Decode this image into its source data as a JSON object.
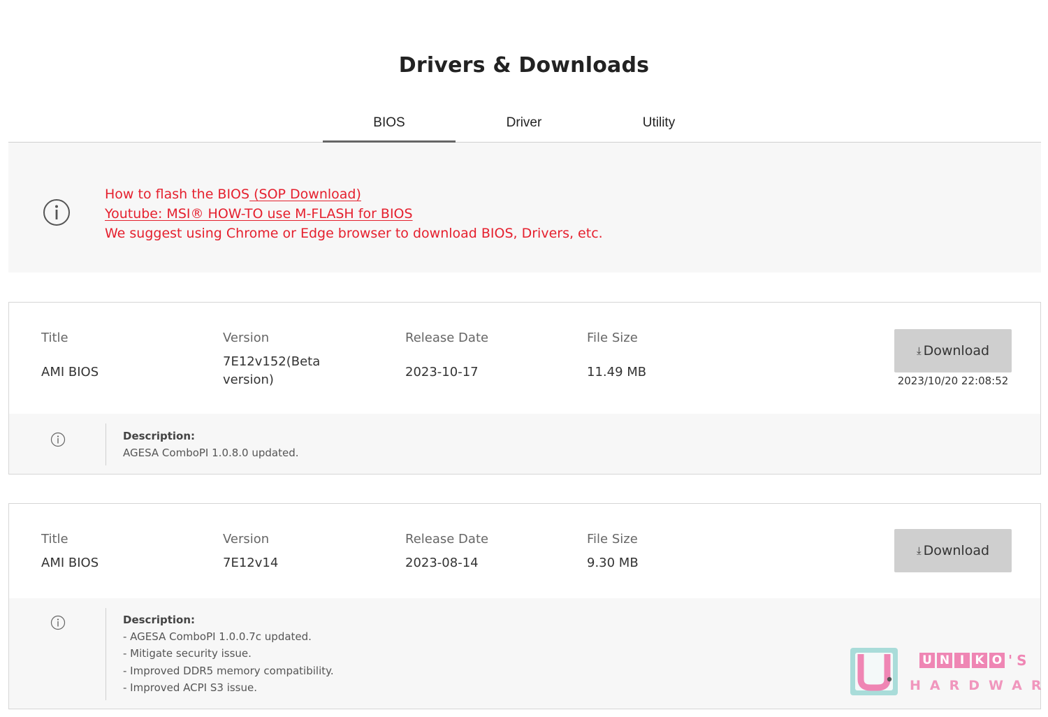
{
  "page": {
    "title": "Drivers & Downloads"
  },
  "tabs": [
    {
      "label": "BIOS",
      "active": true
    },
    {
      "label": "Driver",
      "active": false
    },
    {
      "label": "Utility",
      "active": false
    }
  ],
  "notice": {
    "line1_text": "How to flash the BIOS",
    "line1_link": " (SOP Download)",
    "line2_link": "Youtube: MSI® HOW-TO use M-FLASH for BIOS",
    "line3_text": "We suggest using Chrome or Edge browser to download BIOS, Drivers, etc.",
    "color": "#e5202e"
  },
  "columns": {
    "title": "Title",
    "version": "Version",
    "release_date": "Release Date",
    "file_size": "File Size"
  },
  "downloads": [
    {
      "title": "AMI BIOS",
      "version_line1": "7E12v152(Beta",
      "version_line2": "version)",
      "release_date": "2023-10-17",
      "file_size": "11.49 MB",
      "button_label": "Download",
      "timestamp": "2023/10/20 22:08:52",
      "description_heading": "Description:",
      "description_lines": [
        "AGESA ComboPI 1.0.8.0 updated."
      ]
    },
    {
      "title": "AMI BIOS",
      "version_line1": "7E12v14",
      "release_date": "2023-08-14",
      "file_size": "9.30 MB",
      "button_label": "Download",
      "description_heading": "Description:",
      "description_lines": [
        "- AGESA ComboPI 1.0.0.7c updated.",
        "- Mitigate security issue.",
        "- Improved DDR5 memory compatibility.",
        "- Improved ACPI S3 issue."
      ]
    }
  ],
  "watermark": {
    "letters": [
      "U",
      "N",
      "I",
      "K",
      "O"
    ],
    "suffix": "'S",
    "subtitle": "HARDWARE",
    "color": "#ef86b4"
  },
  "icons": {
    "info": "info-circle-icon",
    "download": "download-arrow-icon"
  }
}
